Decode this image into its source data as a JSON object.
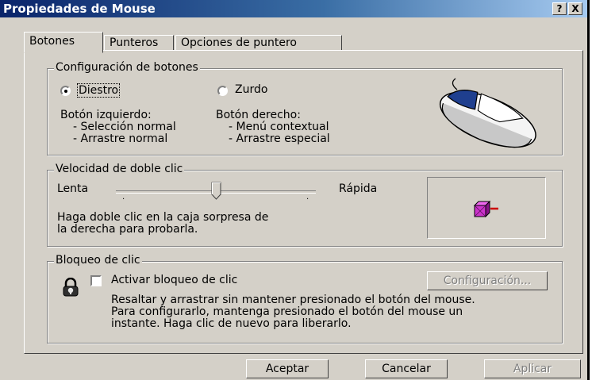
{
  "window": {
    "title": "Propiedades de Mouse",
    "help_label": "?",
    "close_label": "X"
  },
  "tabs": [
    {
      "label": "Botones",
      "active": true
    },
    {
      "label": "Punteros",
      "active": false
    },
    {
      "label": "Opciones de puntero",
      "active": false
    }
  ],
  "buttons_config": {
    "legend": "Configuración de botones",
    "right_handed": "Diestro",
    "left_handed": "Zurdo",
    "selected": "right_handed",
    "left_button_heading": "Botón izquierdo:",
    "left_button_lines": [
      "- Selección normal",
      "- Arrastre normal"
    ],
    "right_button_heading": "Botón derecho:",
    "right_button_lines": [
      "- Menú contextual",
      "- Arrastre especial"
    ]
  },
  "double_click": {
    "legend": "Velocidad de doble clic",
    "slow_label": "Lenta",
    "fast_label": "Rápida",
    "hint": [
      "Haga doble clic en la caja sorpresa de",
      "la derecha para probarla."
    ],
    "speed_fraction": 0.5
  },
  "click_lock": {
    "legend": "Bloqueo de clic",
    "checkbox_label": "Activar bloqueo de clic",
    "checked": false,
    "settings_button": "Configuración...",
    "description": [
      "Resaltar y arrastrar sin mantener presionado el botón del mouse.",
      "Para configurarlo, mantenga presionado el botón del mouse un",
      "instante. Haga clic de nuevo para liberarlo."
    ]
  },
  "footer": {
    "ok": "Aceptar",
    "cancel": "Cancelar",
    "apply": "Aplicar"
  },
  "colors": {
    "titlebar_start": "#0a246a",
    "titlebar_end": "#a6caf0",
    "face": "#d4d0c8",
    "mouse_button": "#1f3f8f",
    "test_box": "#cc33cc"
  }
}
